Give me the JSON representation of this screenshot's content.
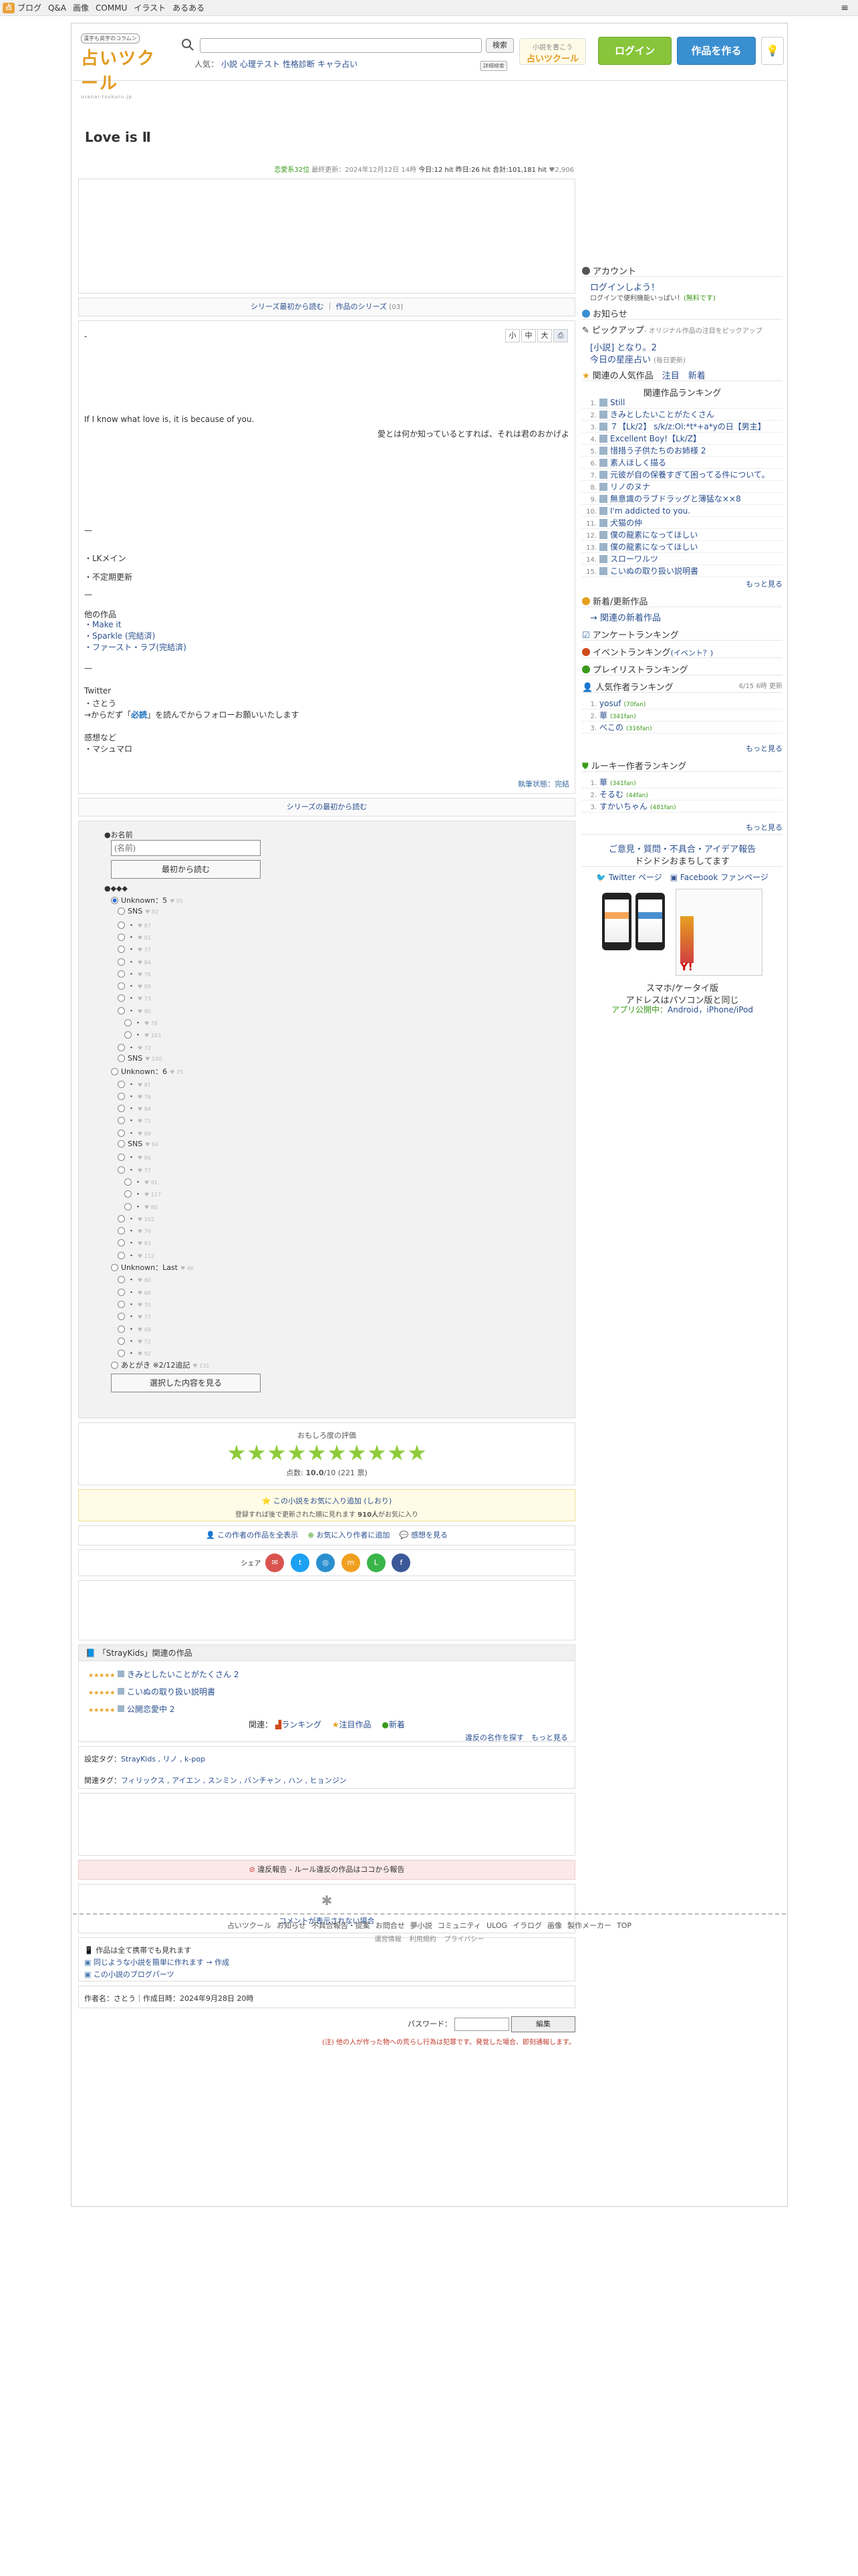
{
  "topbar": {
    "items": [
      "ブログ",
      "Q&A",
      "画像",
      "COMMU",
      "イラスト",
      "あるある"
    ]
  },
  "header": {
    "logo_tag": "漢字も英字のコラムン",
    "logo_name": "占いツクール",
    "logo_sub": "uranai-tsukuru.jp",
    "search_placeholder": "",
    "search_btn": "検索",
    "search_detail": "詳細検索",
    "popular_label": "人気：",
    "popular": [
      "小説",
      "心理テスト",
      "性格診断",
      "キャラ占い"
    ],
    "banner_top": "小説を書こう",
    "banner_main": "占いツクール",
    "login": "ログイン",
    "create": "作品を作る"
  },
  "title": "Love is Ⅱ",
  "stats": {
    "rank": "恋愛系32位",
    "updated": "最終更新：2024年12月12日 14時",
    "today": "今日:12 hit",
    "yesterday": "昨日:26 hit",
    "total": "合計:101,181 hit",
    "likes": "2,906"
  },
  "series": {
    "label": "シリーズ最初から読む",
    "series_link": "作品のシリーズ",
    "count": "[03]"
  },
  "font_sizes": [
    "小",
    "中",
    "大"
  ],
  "body": {
    "dash": "-",
    "quote_en": "If I know what love is, it is because of you.",
    "quote_jp": "愛とは何か知っているとすれば、それは君のおかげよ",
    "sep1": "—",
    "notes": [
      "・LKメイン",
      "・不定期更新"
    ],
    "sep2": "—",
    "other_works_label": "他の作品",
    "other_works": [
      "・Make it",
      "・Sparkle (完結済)",
      "・ファースト・ラブ(完結済)"
    ],
    "sep3": "—",
    "twitter_label": "Twitter",
    "twitter_user": "・さとう",
    "twitter_note_pre": "→からだず「",
    "twitter_note_em": "必読",
    "twitter_note_post": "」を読んでからフォローお願いいたします",
    "feedback_label": "感想など",
    "feedback": "・マシュマロ",
    "status": "執筆状態：完結"
  },
  "reader": {
    "header": "シリーズの最初から読む",
    "name_label": "●お名前",
    "name_placeholder": "(名前)",
    "read_first": "最初から読む",
    "toc_label": "●◆◆◆",
    "chapters": [
      {
        "title": "Unknown：5",
        "meta": "95",
        "level": 0,
        "checked": true
      },
      {
        "title": "SNS",
        "meta": "82",
        "level": 1
      },
      {
        "title": "・",
        "meta": "87",
        "level": 1
      },
      {
        "title": "・",
        "meta": "81",
        "level": 1
      },
      {
        "title": "・",
        "meta": "77",
        "level": 1
      },
      {
        "title": "・",
        "meta": "84",
        "level": 1
      },
      {
        "title": "・",
        "meta": "76",
        "level": 1
      },
      {
        "title": "・",
        "meta": "89",
        "level": 1
      },
      {
        "title": "・",
        "meta": "73",
        "level": 1
      },
      {
        "title": "・",
        "meta": "90",
        "level": 1
      },
      {
        "title": "・",
        "meta": "78",
        "level": 2
      },
      {
        "title": "・",
        "meta": "103",
        "level": 2
      },
      {
        "title": "・",
        "meta": "72",
        "level": 1
      },
      {
        "title": "SNS",
        "meta": "100",
        "level": 1
      },
      {
        "title": "Unknown：6",
        "meta": "75",
        "level": 0
      },
      {
        "title": "・",
        "meta": "81",
        "level": 1
      },
      {
        "title": "・",
        "meta": "76",
        "level": 1
      },
      {
        "title": "・",
        "meta": "84",
        "level": 1
      },
      {
        "title": "・",
        "meta": "71",
        "level": 1
      },
      {
        "title": "・",
        "meta": "69",
        "level": 1
      },
      {
        "title": "SNS",
        "meta": "84",
        "level": 1
      },
      {
        "title": "・",
        "meta": "86",
        "level": 1
      },
      {
        "title": "・",
        "meta": "77",
        "level": 1
      },
      {
        "title": "・",
        "meta": "91",
        "level": 2
      },
      {
        "title": "・",
        "meta": "117",
        "level": 2
      },
      {
        "title": "・",
        "meta": "80",
        "level": 2
      },
      {
        "title": "・",
        "meta": "102",
        "level": 1
      },
      {
        "title": "・",
        "meta": "79",
        "level": 1
      },
      {
        "title": "・",
        "meta": "83",
        "level": 1
      },
      {
        "title": "・",
        "meta": "112",
        "level": 1
      },
      {
        "title": "Unknown：Last",
        "meta": "46",
        "level": 0
      },
      {
        "title": "・",
        "meta": "60",
        "level": 1
      },
      {
        "title": "・",
        "meta": "66",
        "level": 1
      },
      {
        "title": "・",
        "meta": "70",
        "level": 1
      },
      {
        "title": "・",
        "meta": "77",
        "level": 1
      },
      {
        "title": "・",
        "meta": "68",
        "level": 1
      },
      {
        "title": "・",
        "meta": "72",
        "level": 1
      },
      {
        "title": "・",
        "meta": "92",
        "level": 1
      },
      {
        "title": "あとがき ※2/12追記",
        "meta": "131",
        "level": 0
      }
    ],
    "view_selected": "選択した内容を見る"
  },
  "rating": {
    "label": "おもしろ度の評価",
    "score_pre": "点数: ",
    "score": "10.0",
    "score_post": "/10 (221 票)",
    "stars": 10
  },
  "favorite": {
    "main": "この小説をお気に入り追加 (しおり)",
    "sub_pre": "登録すれば後で更新された順に見れます ",
    "sub_count": "910人",
    "sub_post": "がお気に入り"
  },
  "author_links": [
    "この作者の作品を全表示",
    "お気に入り作者に追加",
    "感想を見る"
  ],
  "share_label": "シェア",
  "related": {
    "header": "「StrayKids」関連の作品",
    "items": [
      "きみとしたいことがたくさん 2",
      "こいぬの取り扱い説明書",
      "公開恋愛中 2"
    ],
    "links_label": "関連：",
    "links": [
      "ランキング",
      "注目作品",
      "新着"
    ],
    "more_similar": "違反の名作を探す",
    "more": "もっと見る"
  },
  "tags": {
    "setting_label": "設定タグ：",
    "setting": "StrayKids , リノ , k-pop",
    "related_label": "関連タグ：",
    "related": "フィリックス , アイエン , スンミン , バンチャン , ハン , ヒョンジン"
  },
  "report": "違反報告 - ルール違反の作品はココから報告",
  "comment_fail": "コメントが表示されない場合",
  "misc_links": [
    "作品は全て携帯でも見れます",
    "同じような小説を簡単に作れます → 作成",
    "この小説のブログパーツ"
  ],
  "author_line": "作者名：さとう｜作成日時：2024年9月28日 20時",
  "password_label": "パスワード：",
  "edit_btn": "編集",
  "warning": "(注) 他の人が作った物への荒らし行為は犯罪です。発覚した場合、即刻通報します。",
  "footer": {
    "links": [
      "占いツクール",
      "お知らせ",
      "不具合報告・提案",
      "お問合せ",
      "夢小説",
      "コミュニティ",
      "ULOG",
      "イラログ",
      "画像",
      "製作メーカー",
      "TOP"
    ],
    "links2": [
      "運営情報",
      "利用規約",
      "プライバシー"
    ]
  },
  "sidebar": {
    "account": "アカウント",
    "login_prompt": "ログインしよう！",
    "login_sub_pre": "ログインで便利機能いっぱい！",
    "login_sub_link": "(無料です)",
    "news": "お知らせ",
    "pickup": "ピックアップ",
    "pickup_sub": "- オリジナル作品の注目をピックアップ",
    "pickup_items": [
      "[小説] となり。2",
      "今日の星座占い"
    ],
    "pickup_meta": "(毎日更新)",
    "related_popular": "関連の人気作品",
    "related_tabs": [
      "注目",
      "新着"
    ],
    "ranking_header": "関連作品ランキング",
    "ranking": [
      "Still",
      "きみとしたいことがたくさん",
      "７【Lk/2】 s/k/z:Ol:*t*+a*yの日【男主】",
      "Excellent Boy!【Lk/Z】",
      "惜措う子供たちのお姉様 2",
      "素人ほしく描る",
      "元彼が自の保養すぎて困ってる件について。",
      "リノのヌナ",
      "無意識のラブドラッグと薄猛な××8",
      "I'm addicted to you.",
      "犬猫の仲",
      "僕の龍素になってほしい",
      "僕の龍素になってほしい",
      "スローワルツ",
      "こいぬの取り扱い説明書"
    ],
    "more": "もっと見る",
    "new_updates": "新着/更新作品",
    "new_updates_link": "→ 関連の新着作品",
    "survey": "アンケートランキング",
    "event": "イベントランキング",
    "event_sub": "(イベント？)",
    "playlist": "プレイリストランキング",
    "author_rank": "人気作者ランキング",
    "author_rank_date": "6/15 6時 更新",
    "authors": [
      {
        "name": "yosuf",
        "meta": "(70fan)"
      },
      {
        "name": "華",
        "meta": "(341fan)"
      },
      {
        "name": "べこの",
        "meta": "(316fan)"
      }
    ],
    "rookie_rank": "ルーキー作者ランキング",
    "rookies": [
      {
        "name": "華",
        "meta": "(341fan)"
      },
      {
        "name": "そるむ",
        "meta": "(44fan)"
      },
      {
        "name": "すかいちゃん",
        "meta": "(481fan)"
      }
    ],
    "feedback": "ご意見・質問・不具合・アイデア報告",
    "feedback_sub": "ドシドシおまちしてます",
    "twitter": "Twitter ページ",
    "facebook": "Facebook ファンページ",
    "mobile_title": "スマホ/ケータイ版",
    "mobile_sub": "アドレスはパソコン版と同じ",
    "app_pre": "アプリ公開中：",
    "app": "Android，iPhone/iPod"
  }
}
